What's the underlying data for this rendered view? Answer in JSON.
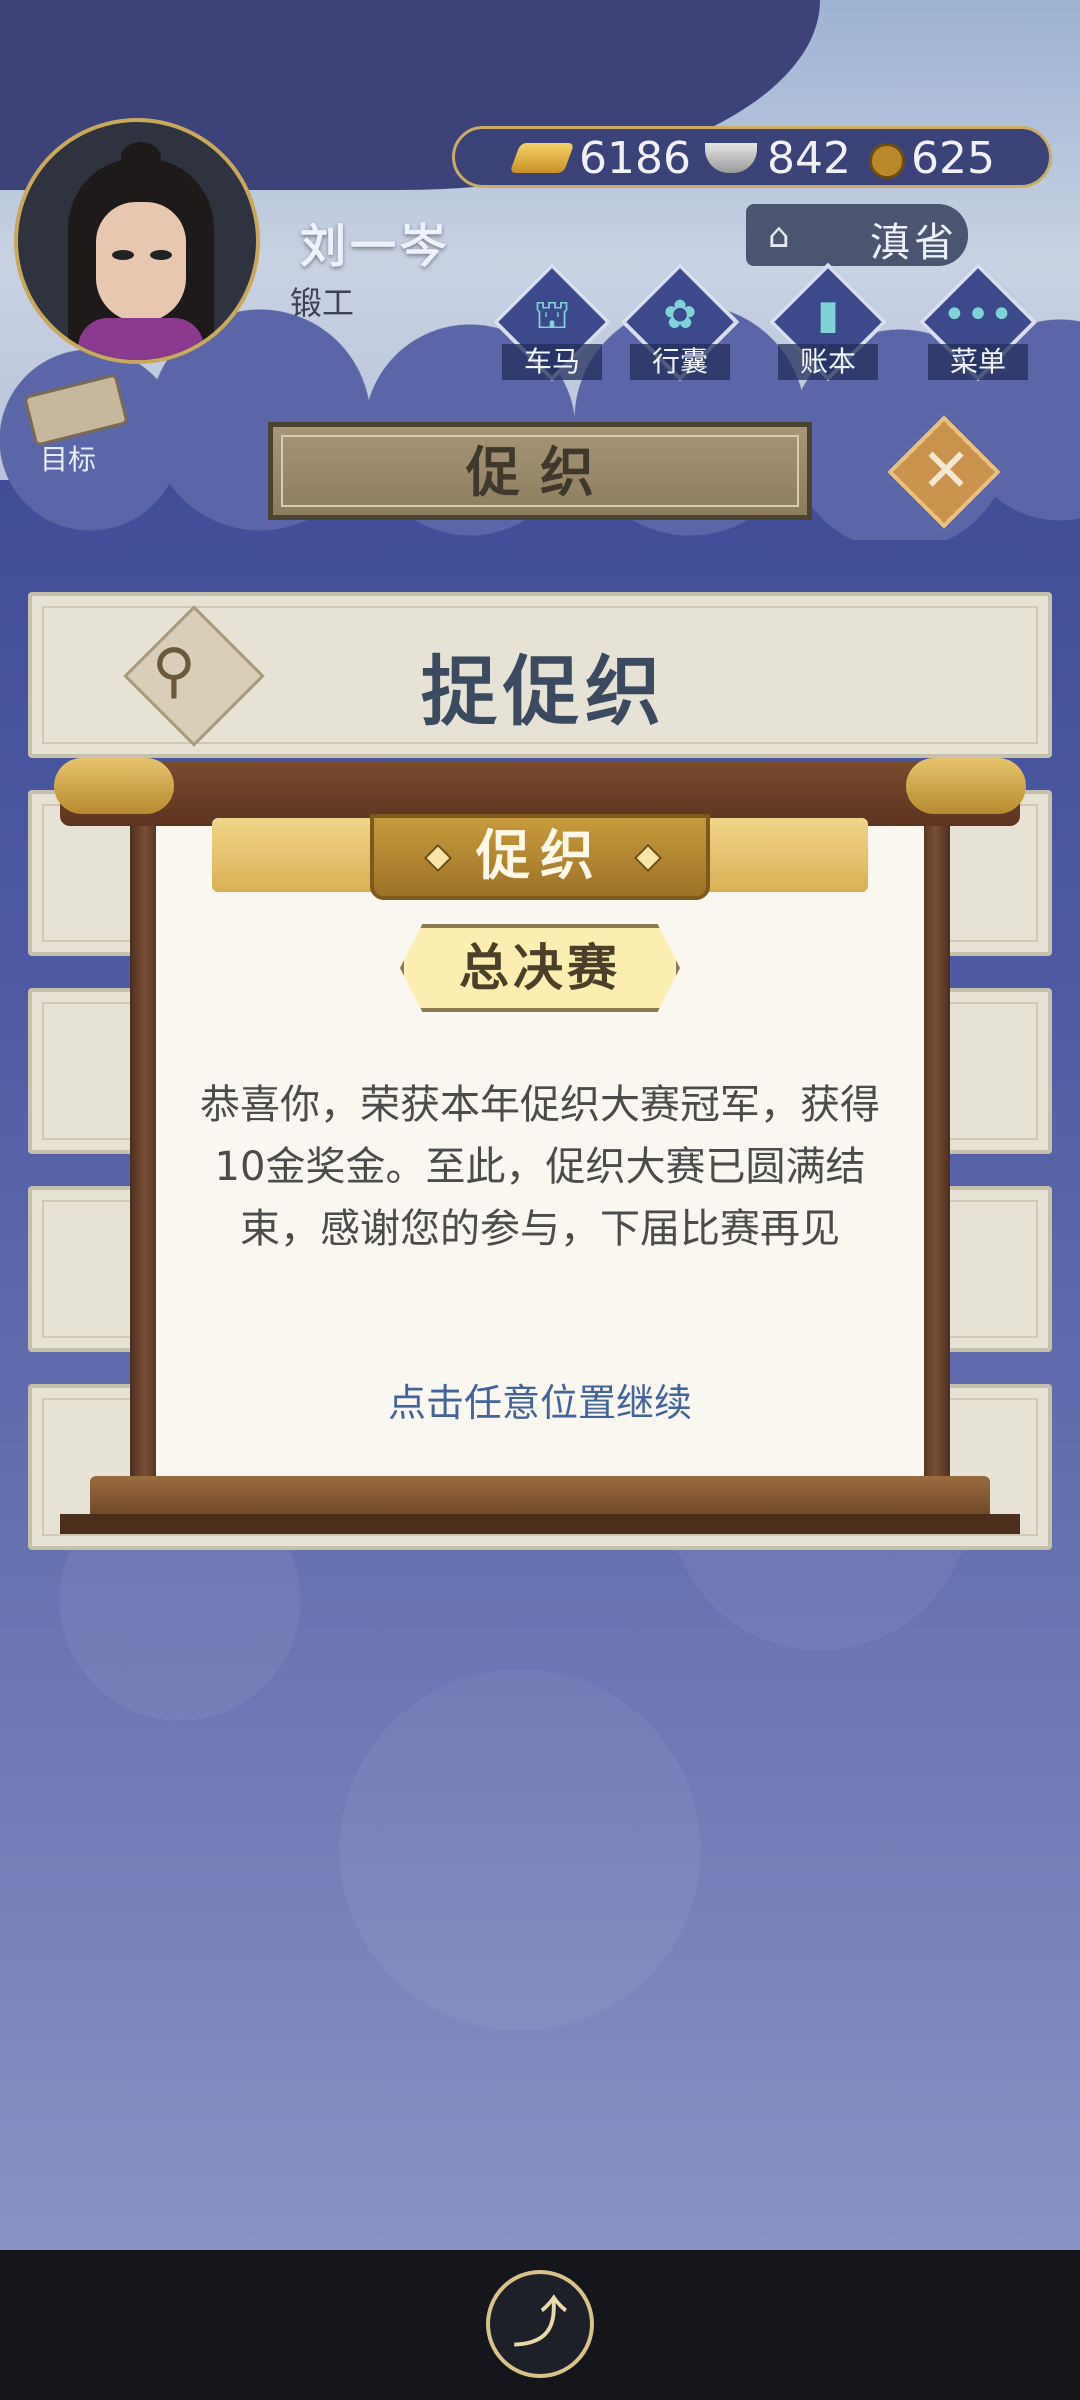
{
  "player": {
    "name": "刘一岑",
    "title": "锻工"
  },
  "currency": {
    "gold": "6186",
    "silver": "842",
    "coins": "625"
  },
  "location": {
    "province": "滇省"
  },
  "nav": [
    {
      "label": "车马",
      "icon": "carriage-icon",
      "glyph": "⛫"
    },
    {
      "label": "行囊",
      "icon": "bag-icon",
      "glyph": "✿"
    },
    {
      "label": "账本",
      "icon": "ledger-icon",
      "glyph": "▮"
    },
    {
      "label": "菜单",
      "icon": "menu-icon",
      "glyph": "•••"
    }
  ],
  "goal": {
    "label": "目标"
  },
  "header": {
    "title": "促织",
    "close_glyph": "✕"
  },
  "panel": {
    "title": "捉促织"
  },
  "modal": {
    "banner_title": "促织",
    "subtitle": "总决赛",
    "message": "恭喜你，荣获本年促织大赛冠军，获得10金奖金。至此，促织大赛已圆满结束，感谢您的参与，下届比赛再见",
    "hint": "点击任意位置继续"
  },
  "system": {
    "share_glyph": "⤴"
  },
  "colors": {
    "accent": "#c9ad67",
    "hint": "#43639b",
    "background": "#3f4a8f"
  }
}
